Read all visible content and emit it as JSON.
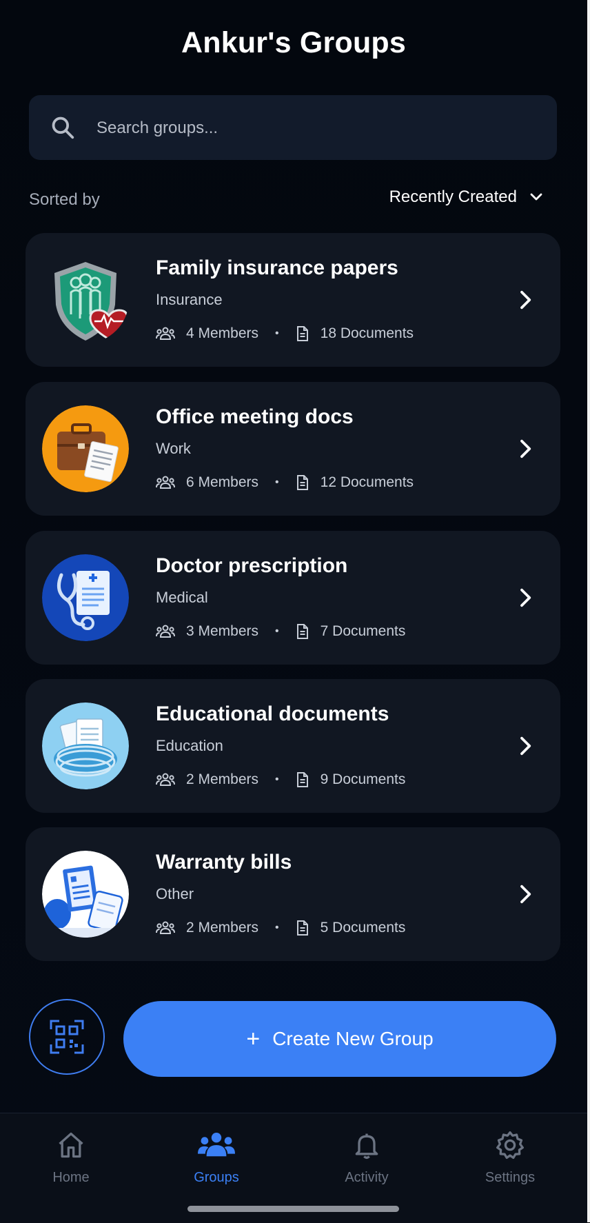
{
  "header": {
    "title": "Ankur's Groups"
  },
  "search": {
    "placeholder": "Search groups...",
    "value": ""
  },
  "sort": {
    "label": "Sorted by",
    "selected": "Recently Created"
  },
  "groups": [
    {
      "title": "Family insurance papers",
      "category": "Insurance",
      "members": "4 Members",
      "documents": "18 Documents",
      "icon": "insurance-shield-icon"
    },
    {
      "title": "Office meeting docs",
      "category": "Work",
      "members": "6 Members",
      "documents": "12 Documents",
      "icon": "briefcase-icon"
    },
    {
      "title": "Doctor prescription",
      "category": "Medical",
      "members": "3 Members",
      "documents": "7 Documents",
      "icon": "stethoscope-icon"
    },
    {
      "title": "Educational documents",
      "category": "Education",
      "members": "2 Members",
      "documents": "9 Documents",
      "icon": "documents-nest-icon"
    },
    {
      "title": "Warranty bills",
      "category": "Other",
      "members": "2 Members",
      "documents": "5 Documents",
      "icon": "receipt-documents-icon"
    }
  ],
  "actions": {
    "create_label": "Create New Group",
    "qr_icon": "qr-scan-icon"
  },
  "nav": {
    "items": [
      {
        "label": "Home",
        "icon": "home-icon"
      },
      {
        "label": "Groups",
        "icon": "groups-icon"
      },
      {
        "label": "Activity",
        "icon": "bell-icon"
      },
      {
        "label": "Settings",
        "icon": "gear-icon"
      }
    ],
    "active": "Groups"
  },
  "colors": {
    "accent": "#3b80f5",
    "background": "#050a14",
    "card": "#111722",
    "muted_text": "#a6adb9"
  }
}
